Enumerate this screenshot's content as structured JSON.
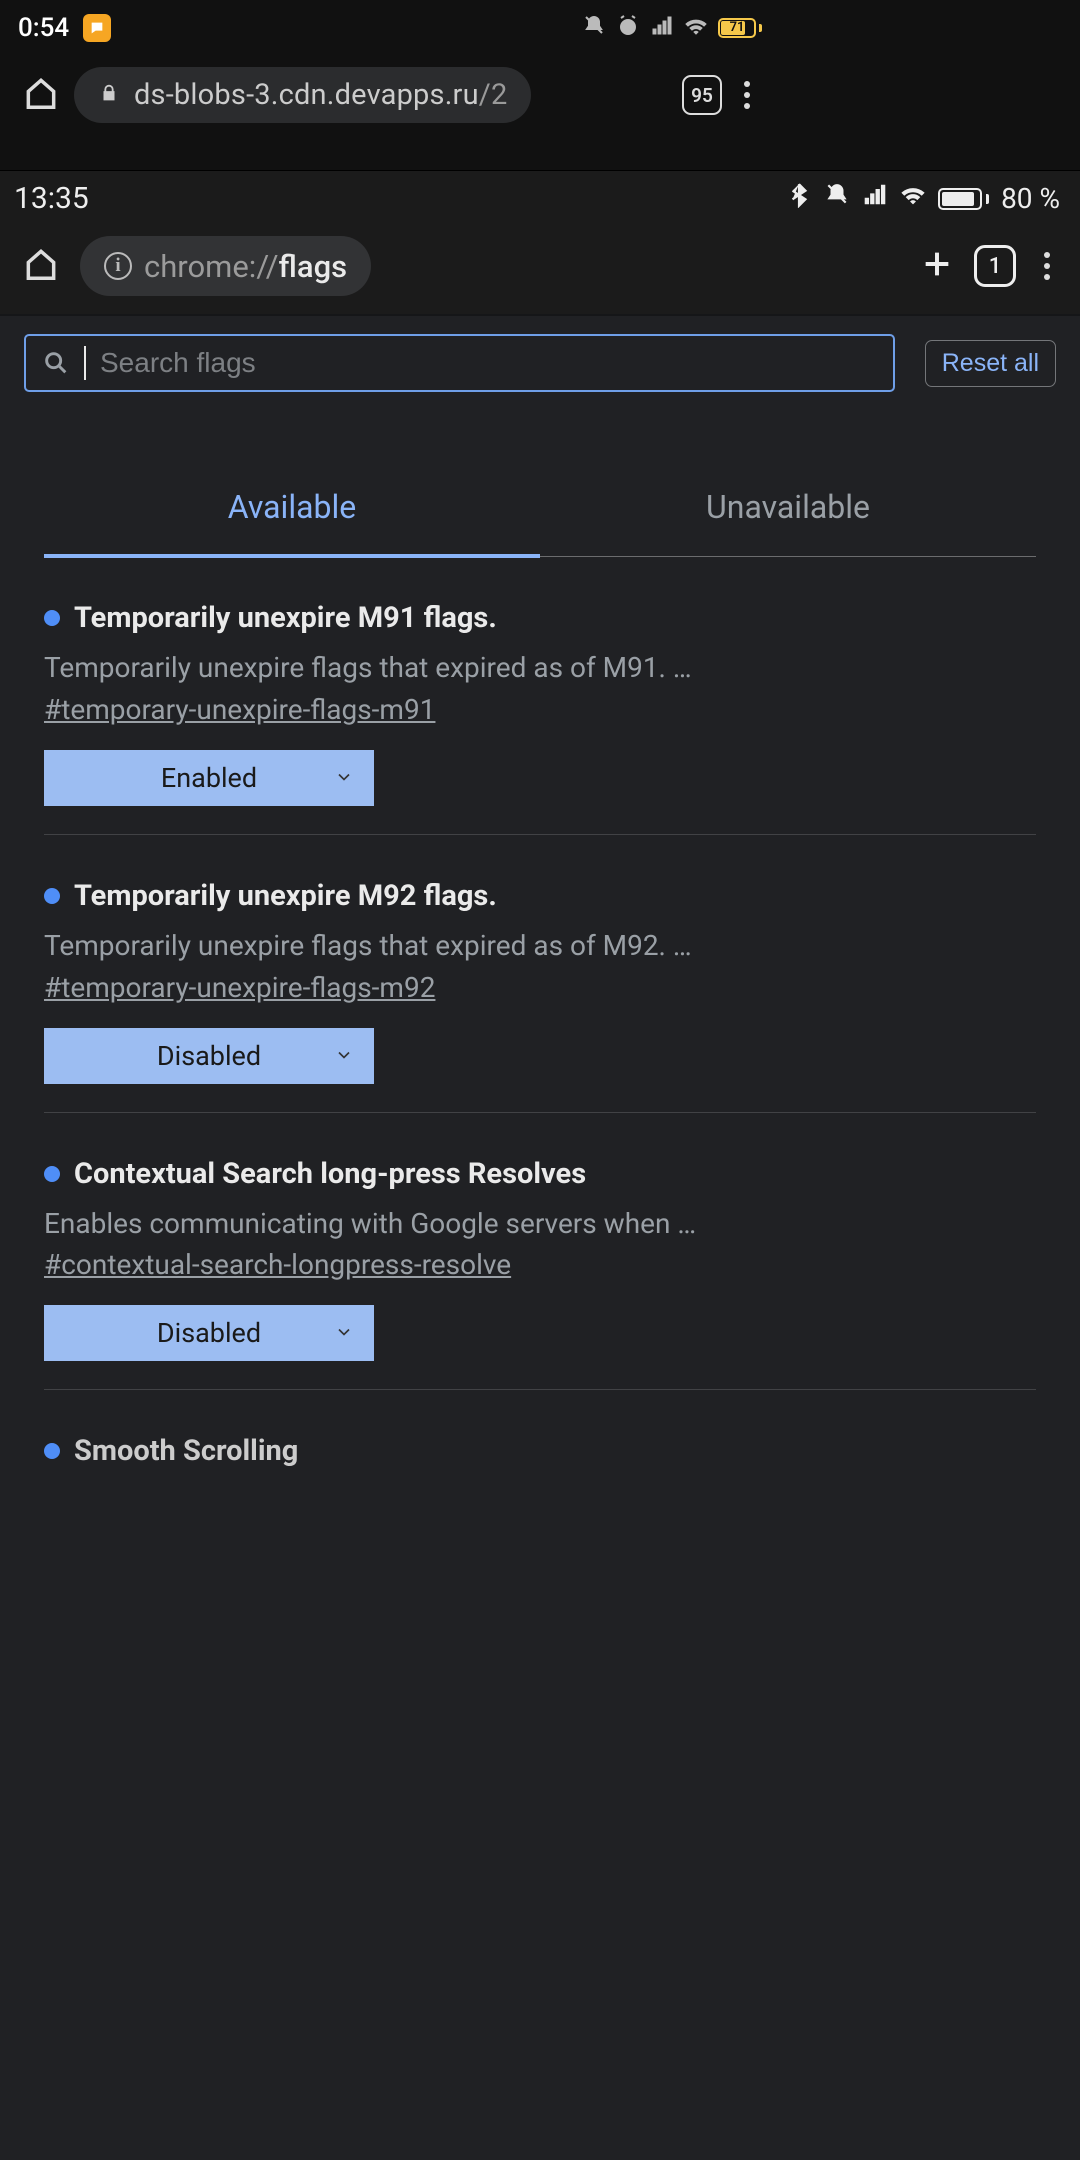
{
  "outer_status": {
    "time": "0:54",
    "battery_level": "71"
  },
  "outer_chrome": {
    "url_display_host": "ds-blobs-3.cdn.devapps.ru",
    "url_display_path": "/2",
    "tab_count": "95"
  },
  "inner_status": {
    "time": "13:35",
    "battery_text": "80 %"
  },
  "inner_chrome": {
    "url_scheme": "chrome://",
    "url_path": "flags",
    "tab_count": "1"
  },
  "flags_ui": {
    "search_placeholder": "Search flags",
    "reset_label": "Reset all",
    "tabs": {
      "available": "Available",
      "unavailable": "Unavailable"
    },
    "items": [
      {
        "title": "Temporarily unexpire M91 flags.",
        "desc": "Temporarily unexpire flags that expired as of M91. …",
        "anchor": "#temporary-unexpire-flags-m91",
        "value": "Enabled"
      },
      {
        "title": "Temporarily unexpire M92 flags.",
        "desc": "Temporarily unexpire flags that expired as of M92. …",
        "anchor": "#temporary-unexpire-flags-m92",
        "value": "Disabled"
      },
      {
        "title": "Contextual Search long-press Resolves",
        "desc": "Enables communicating with Google servers when …",
        "anchor": "#contextual-search-longpress-resolve",
        "value": "Disabled"
      },
      {
        "title": "Smooth Scrolling",
        "desc": "",
        "anchor": "",
        "value": ""
      }
    ]
  }
}
